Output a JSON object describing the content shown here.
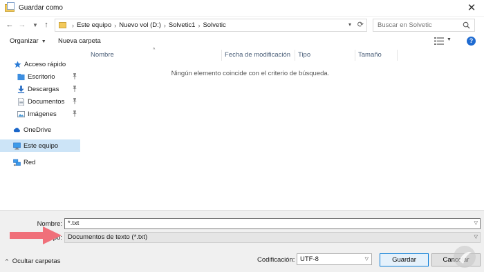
{
  "window": {
    "title": "Guardar como"
  },
  "navigation": {
    "breadcrumb": [
      "Este equipo",
      "Nuevo vol (D:)",
      "Solvetic1",
      "Solvetic"
    ],
    "search_placeholder": "Buscar en Solvetic"
  },
  "toolbar": {
    "organize_label": "Organizar",
    "new_folder_label": "Nueva carpeta"
  },
  "sidebar": {
    "items": [
      {
        "label": "Acceso rápido",
        "icon": "star-icon"
      },
      {
        "label": "Escritorio",
        "icon": "desktop-folder-icon",
        "pinned": true
      },
      {
        "label": "Descargas",
        "icon": "downloads-icon",
        "pinned": true
      },
      {
        "label": "Documentos",
        "icon": "documents-icon",
        "pinned": true
      },
      {
        "label": "Imágenes",
        "icon": "pictures-icon",
        "pinned": true
      },
      {
        "label": "OneDrive",
        "icon": "cloud-icon"
      },
      {
        "label": "Este equipo",
        "icon": "computer-icon",
        "selected": true
      },
      {
        "label": "Red",
        "icon": "network-icon"
      }
    ]
  },
  "file_list": {
    "columns": [
      "Nombre",
      "Fecha de modificación",
      "Tipo",
      "Tamaño"
    ],
    "empty_message": "Ningún elemento coincide con el criterio de búsqueda."
  },
  "form": {
    "name_label": "Nombre:",
    "name_value": "*.txt",
    "type_label": "Tipo:",
    "type_value": "Documentos de texto (*.txt)",
    "encoding_label": "Codificación:",
    "encoding_value": "UTF-8",
    "hide_folders_label": "Ocultar carpetas",
    "save_label": "Guardar",
    "cancel_label": "Cancelar"
  },
  "colors": {
    "selection": "#cce4f7",
    "accent": "#0078d7",
    "highlight_arrow": "#f0707a",
    "help": "#1f6bd1"
  }
}
